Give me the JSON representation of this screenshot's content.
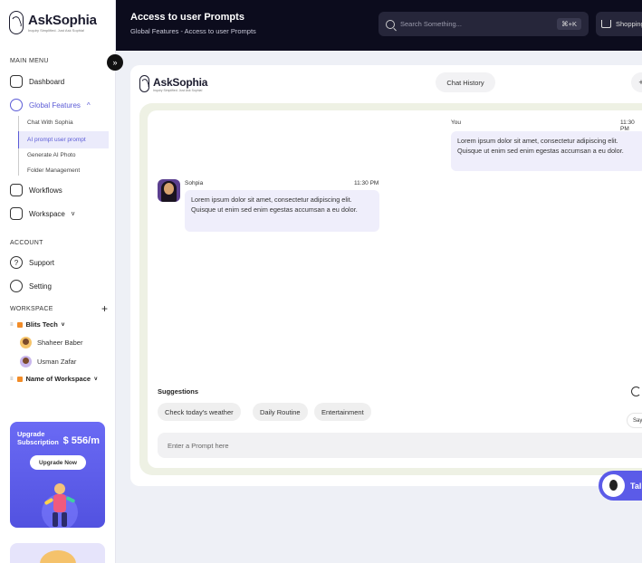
{
  "sidebar": {
    "brand": {
      "name": "AskSophia",
      "tagline": "Inquiry Simplified. Just Ask Sophia!"
    },
    "main_menu_label": "MAIN MENU",
    "dashboard": "Dashboard",
    "global_features": "Global Features",
    "sub_items": [
      "Chat With Sophia",
      "AI prompt user prompt",
      "Generate AI Photo",
      "Folder Management"
    ],
    "workflows": "Workflows",
    "workspace": "Workspace",
    "account_label": "ACCOUNT",
    "support": "Support",
    "setting": "Setting",
    "workspace_label": "WORKSPACE",
    "add_symbol": "+",
    "workspaces": [
      {
        "name": "Blits Tech",
        "members": [
          "Shaheer Baber",
          "Usman Zafar"
        ]
      },
      {
        "name": "Name of Workspace",
        "members": []
      }
    ],
    "upgrade": {
      "title": "Upgrade Subscription",
      "price": "$ 556/m",
      "button": "Upgrade Now"
    }
  },
  "header": {
    "title": "Access to user Prompts",
    "subtitle": "Global Features - Access to user Prompts",
    "search_placeholder": "Search Something...",
    "shortcut": "⌘+K",
    "shopping": "Shopping"
  },
  "card": {
    "brand": {
      "name": "AskSophia",
      "tagline": "Inquiry Simplified. Just Ask Sophia!"
    },
    "chat_history": "Chat History",
    "add_symbol": "+"
  },
  "messages": {
    "user": {
      "name": "You",
      "time": "11:30 PM",
      "text": "Lorem ipsum dolor sit amet, consectetur adipiscing elit. Quisque ut enim sed enim egestas accumsan a eu dolor."
    },
    "bot": {
      "name": "Sohpia",
      "time": "11:30 PM",
      "text": "Lorem ipsum dolor sit amet, consectetur adipiscing elit. Quisque ut enim sed enim egestas accumsan a eu dolor."
    }
  },
  "suggestions": {
    "label": "Suggestions",
    "chips": [
      "Check today's weather",
      "Daily Routine",
      "Entertainment"
    ],
    "say": "Say"
  },
  "prompt": {
    "placeholder": "Enter a Prompt here"
  },
  "talk_button": "Talk"
}
